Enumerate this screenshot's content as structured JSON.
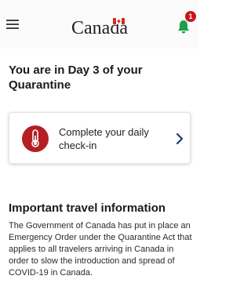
{
  "header": {
    "brand": "Canada",
    "notification_count": "1",
    "colors": {
      "brand_red": "#d52b1e",
      "badge_red": "#c8161d"
    }
  },
  "status": {
    "title": "You are in Day 3 of your Quarantine"
  },
  "checkin": {
    "label": "Complete your daily check-in",
    "icon": "thermometer-icon",
    "icon_bg": "#b51f24"
  },
  "travel": {
    "title": "Important travel information",
    "body": "The Government of Canada has put in place an Emergency Order under the Quarantine Act that applies to all travelers arriving in Canada in order to slow the introduction and spread of COVID-19 in Canada."
  }
}
